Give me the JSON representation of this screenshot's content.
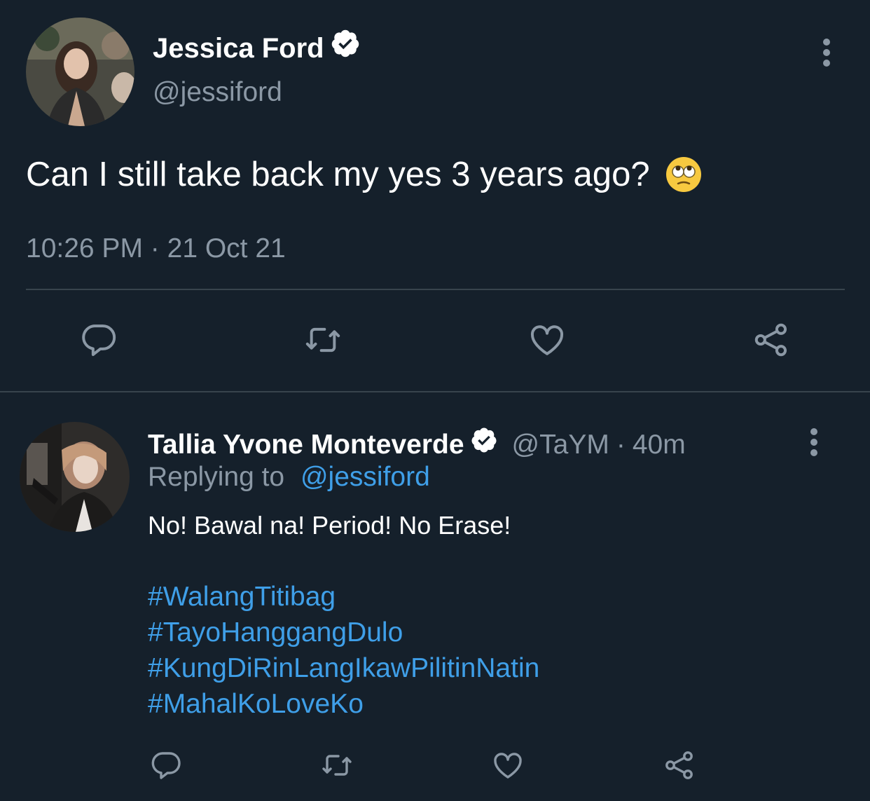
{
  "main_tweet": {
    "author_name": "Jessica Ford",
    "author_handle": "@jessiford",
    "verified": true,
    "text": "Can I still take back my yes 3 years ago?",
    "emoji": "face-with-rolling-eyes",
    "time": "10:26 PM",
    "separator": "·",
    "date": "21 Oct 21",
    "actions": [
      "reply",
      "retweet",
      "like",
      "share"
    ]
  },
  "reply": {
    "author_name": "Tallia Yvone Monteverde",
    "author_handle": "@TaYM",
    "separator": "·",
    "time_ago": "40m",
    "verified": true,
    "replying_label": "Replying to",
    "replying_mention": "@jessiford",
    "text": "No! Bawal na! Period! No Erase!",
    "hashtags": [
      "#WalangTitibag",
      "#TayoHanggangDulo",
      "#KungDiRinLangIkawPilitinNatin",
      "#MahalKoLoveKo"
    ],
    "actions": [
      "reply",
      "retweet",
      "like",
      "share"
    ]
  },
  "colors": {
    "background": "#15202b",
    "primary_text": "#ffffff",
    "secondary_text": "#8b98a5",
    "link": "#3f9fe8",
    "divider": "#38444d"
  }
}
